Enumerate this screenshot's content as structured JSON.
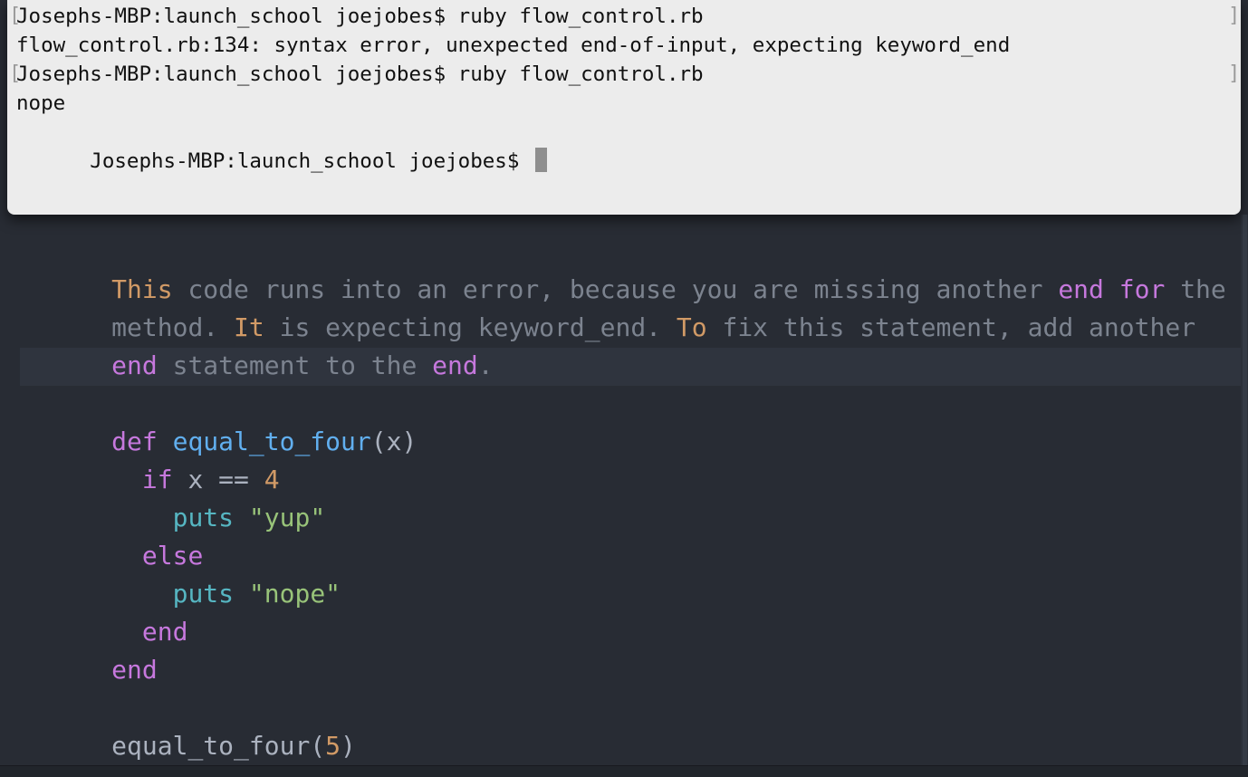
{
  "terminal": {
    "lines": [
      "Josephs-MBP:launch_school joejobes$ ruby flow_control.rb",
      "flow_control.rb:134: syntax error, unexpected end-of-input, expecting keyword_end",
      "Josephs-MBP:launch_school joejobes$ ruby flow_control.rb",
      "nope",
      "Josephs-MBP:launch_school joejobes$ "
    ],
    "bracket_open": "[",
    "bracket_close": "]"
  },
  "editor": {
    "comment": {
      "line1": {
        "t1": "This",
        "t2": " code runs into an error, because you are missing another ",
        "t3": "end",
        "t4": " ",
        "t5": "for",
        "t6": " the"
      },
      "line2": {
        "t1": "method. ",
        "t2": "It",
        "t3": " is expecting keyword_end. ",
        "t4": "To",
        "t5": " fix this statement, add another"
      },
      "line3": {
        "t1": "end",
        "t2": " statement to the ",
        "t3": "end",
        "t4": "."
      }
    },
    "code": {
      "def_kw": "def",
      "method_name": "equal_to_four",
      "params": "(x)",
      "if_kw": "if",
      "condition": " x == ",
      "condition_value": "4",
      "puts1": "puts",
      "string1": "\"yup\"",
      "else_kw": "else",
      "puts2": "puts",
      "string2": "\"nope\"",
      "end_inner": "end",
      "end_outer": "end",
      "call_name": "equal_to_four(",
      "call_arg": "5",
      "call_close": ")"
    }
  },
  "colors": {
    "editor_bg": "#282c34",
    "terminal_bg": "#ececec",
    "comment": "#7c838f",
    "keyword": "#c678dd",
    "function": "#61afef",
    "builtin": "#56b6c2",
    "string": "#98c379",
    "number": "#d19a66"
  }
}
